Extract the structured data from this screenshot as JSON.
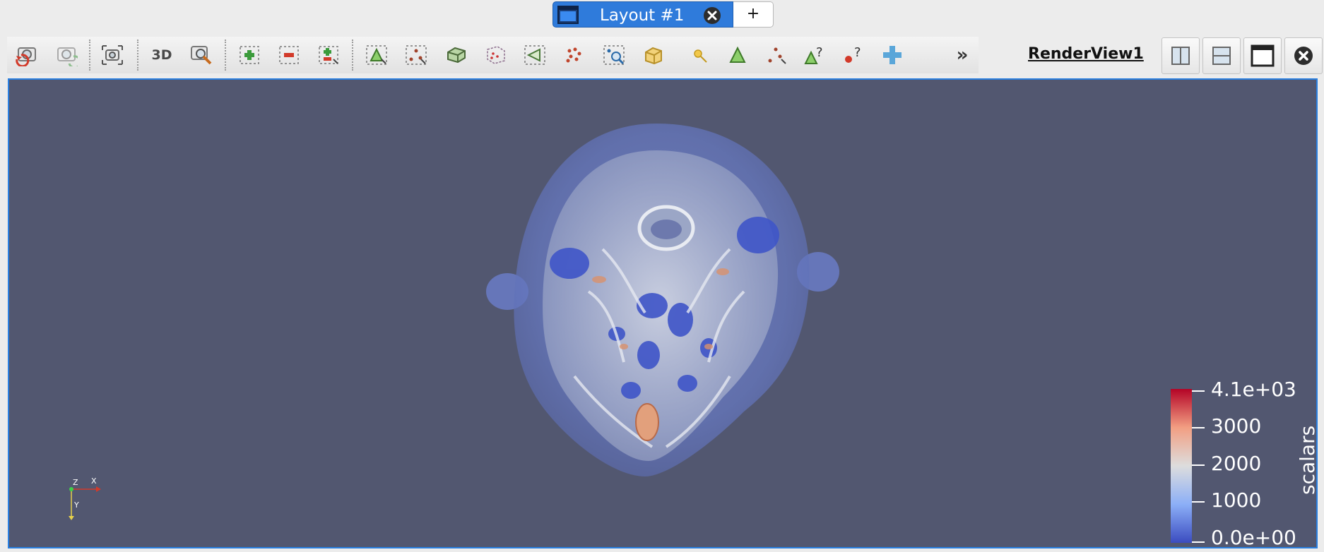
{
  "tabs": {
    "layout_label": "Layout #1",
    "add_label": "+"
  },
  "toolbar": {
    "buttons": [
      {
        "name": "reset-camera-icon"
      },
      {
        "name": "reset-camera-closest-icon"
      },
      {
        "name": "screenshot-icon"
      },
      {
        "name": "toggle-3d",
        "label": "3D"
      },
      {
        "name": "zoom-to-box-icon"
      },
      {
        "name": "select-cells-on-icon"
      },
      {
        "name": "remove-selection-icon"
      },
      {
        "name": "add-selection-icon"
      },
      {
        "name": "select-cells-triangle-icon"
      },
      {
        "name": "select-points-icon"
      },
      {
        "name": "select-block-icon"
      },
      {
        "name": "select-cells-frustum-icon"
      },
      {
        "name": "select-points-frustum-icon"
      },
      {
        "name": "select-points-polygon-icon"
      },
      {
        "name": "interactive-select-points-icon"
      },
      {
        "name": "select-block-cube-icon"
      },
      {
        "name": "hover-points-icon"
      },
      {
        "name": "hover-cells-icon"
      },
      {
        "name": "select-points-polyline-icon"
      },
      {
        "name": "grow-selection-icon"
      },
      {
        "name": "query-points-icon"
      },
      {
        "name": "add-plus-icon"
      }
    ],
    "more_label": "»"
  },
  "view": {
    "title": "RenderView1",
    "controls": [
      "split-horizontal-icon",
      "split-vertical-icon",
      "maximize-icon",
      "close-view-icon"
    ]
  },
  "colorbar": {
    "title": "scalars",
    "labels": [
      "4.1e+03",
      "3000",
      "2000",
      "1000",
      "0.0e+00"
    ],
    "colormap": [
      "#3b4cc0",
      "#8caff7",
      "#dddddd",
      "#f29e82",
      "#b40426"
    ]
  },
  "axes": {
    "x": "X",
    "y": "Y",
    "z": "Z"
  },
  "colors": {
    "background": "#525770",
    "accent": "#2f7bdb"
  }
}
